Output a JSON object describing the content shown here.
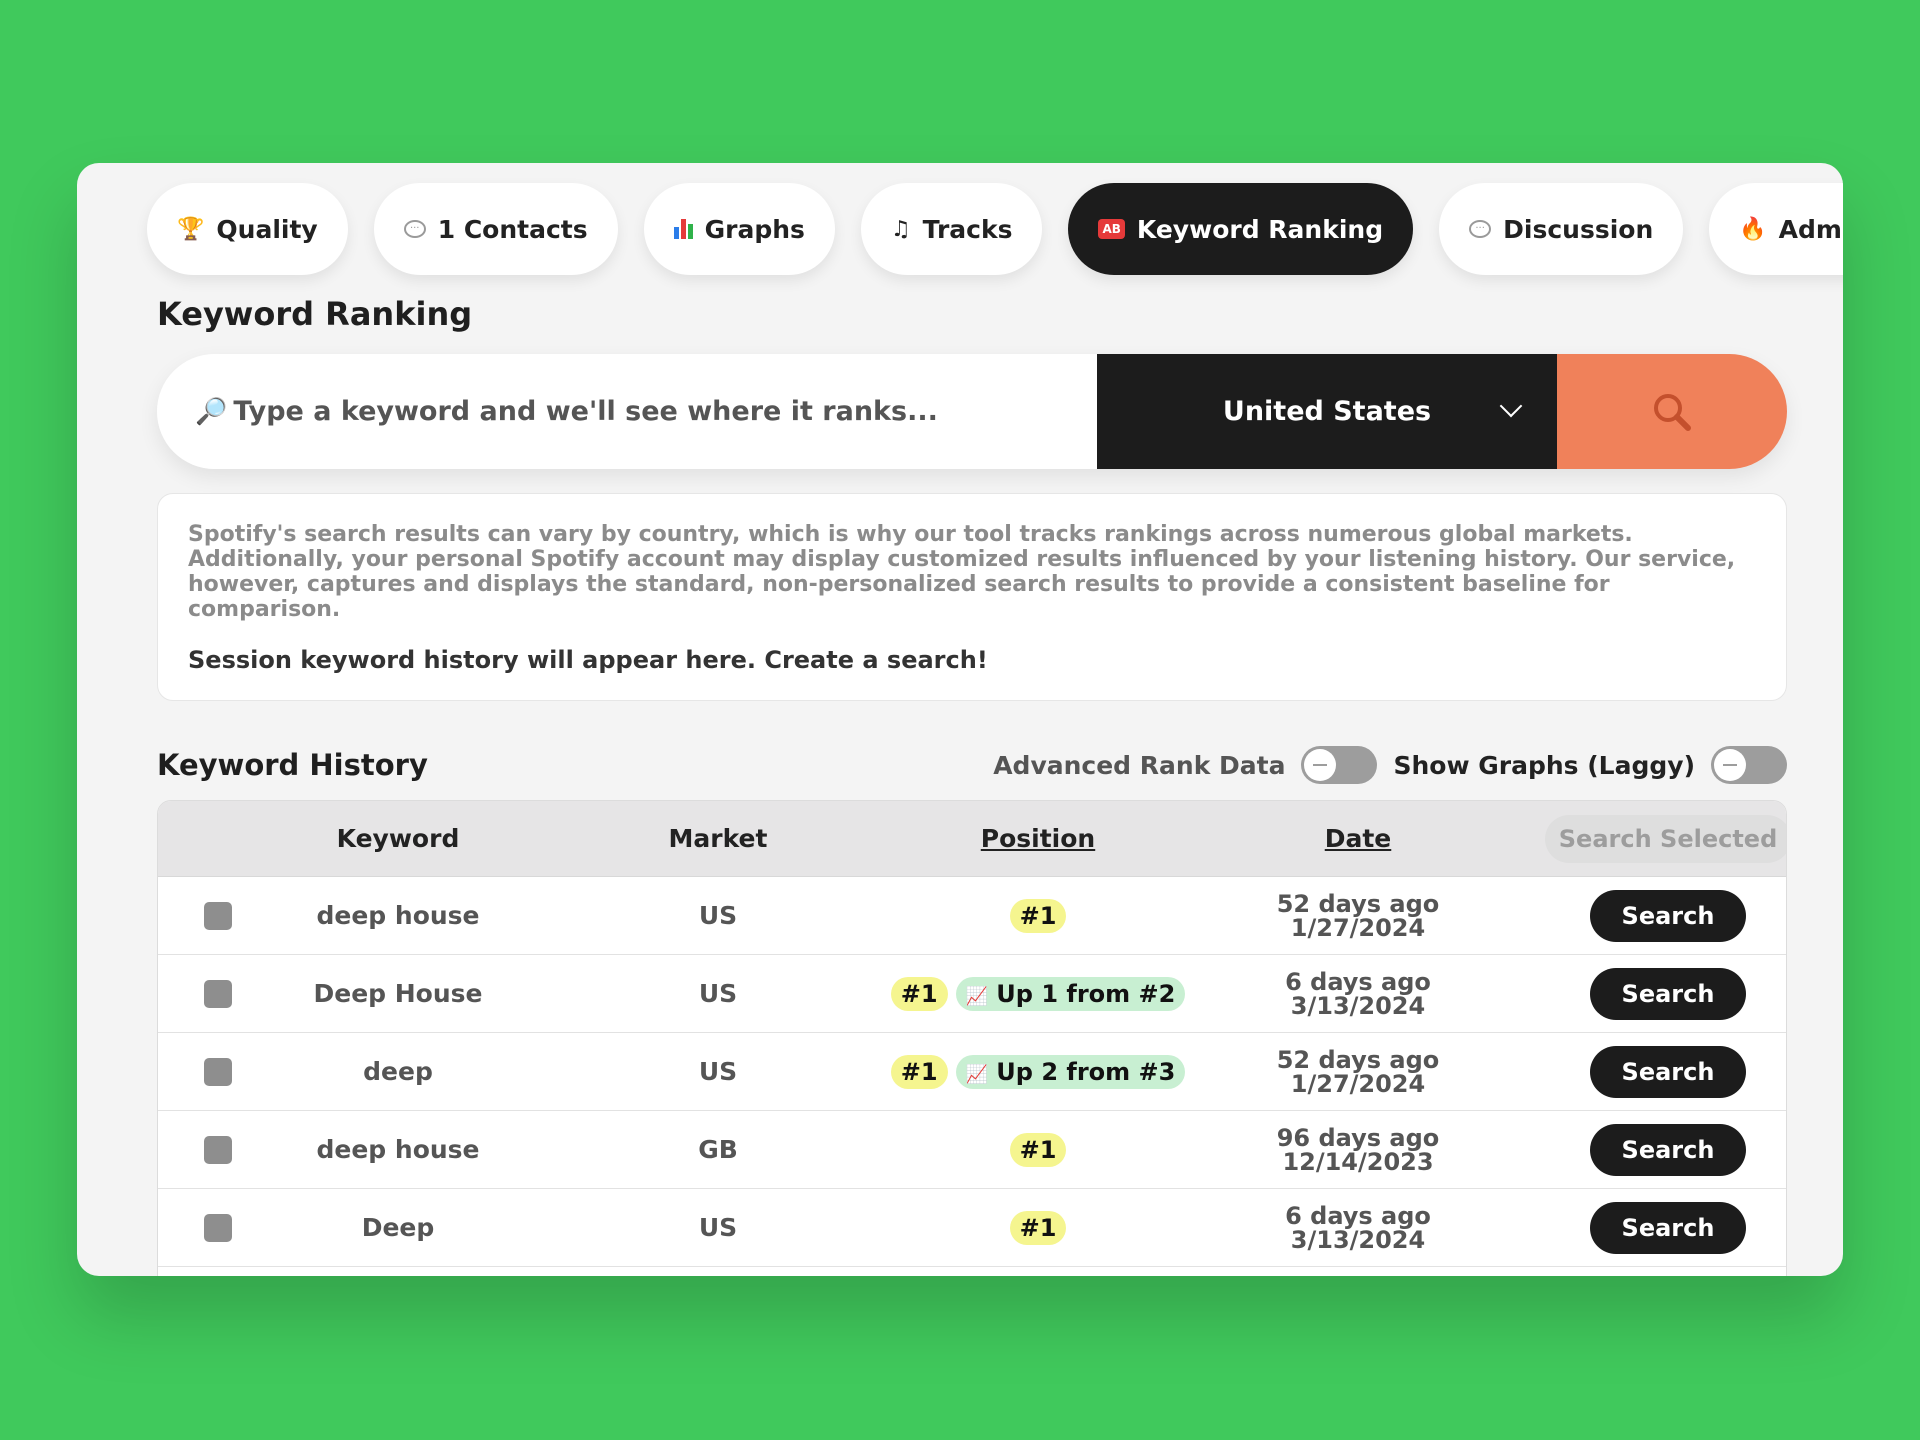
{
  "tabs": [
    {
      "label": "Quality",
      "icon": "trophy-icon"
    },
    {
      "label": "1 Contacts",
      "icon": "chat-bubble-icon"
    },
    {
      "label": "Graphs",
      "icon": "bar-chart-icon"
    },
    {
      "label": "Tracks",
      "icon": "music-note-icon"
    },
    {
      "label": "Keyword Ranking",
      "icon": "ab-icon",
      "active": true
    },
    {
      "label": "Discussion",
      "icon": "chat-bubble-icon"
    },
    {
      "label": "Admin",
      "icon": "fire-icon"
    }
  ],
  "page_title": "Keyword Ranking",
  "search": {
    "placeholder": "Type a keyword and we'll see where it ranks...",
    "market": "United States"
  },
  "info": {
    "description": "Spotify's search results can vary by country, which is why our tool tracks rankings across numerous global markets. Additionally, your personal Spotify account may display customized results influenced by your listening history. Our service, however, captures and displays the standard, non-personalized search results to provide a consistent baseline for comparison.",
    "history_note": "Session keyword history will appear here. Create a search!"
  },
  "history": {
    "title": "Keyword History",
    "toggle_advanced": "Advanced Rank Data",
    "toggle_graphs": "Show Graphs (Laggy)",
    "columns": {
      "keyword": "Keyword",
      "market": "Market",
      "position": "Position",
      "date": "Date",
      "action": "Search Selected"
    },
    "rows": [
      {
        "keyword": "deep house",
        "market": "US",
        "rank": "#1",
        "change": "",
        "ago": "52 days ago",
        "date": "1/27/2024",
        "action": "Search"
      },
      {
        "keyword": "Deep House",
        "market": "US",
        "rank": "#1",
        "change": "Up 1 from #2",
        "ago": "6 days ago",
        "date": "3/13/2024",
        "action": "Search"
      },
      {
        "keyword": "deep",
        "market": "US",
        "rank": "#1",
        "change": "Up 2 from #3",
        "ago": "52 days ago",
        "date": "1/27/2024",
        "action": "Search"
      },
      {
        "keyword": "deep house",
        "market": "GB",
        "rank": "#1",
        "change": "",
        "ago": "96 days ago",
        "date": "12/14/2023",
        "action": "Search"
      },
      {
        "keyword": "Deep",
        "market": "US",
        "rank": "#1",
        "change": "",
        "ago": "6 days ago",
        "date": "3/13/2024",
        "action": "Search"
      }
    ]
  },
  "colors": {
    "background": "#40c95c",
    "accent": "#f0815a",
    "dark": "#1c1c1c",
    "rank_pill": "#f5f58f",
    "change_pill": "#c8efd2"
  }
}
